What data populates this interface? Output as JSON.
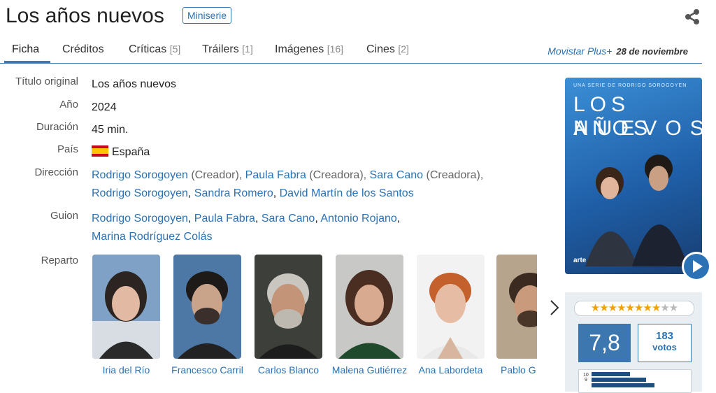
{
  "header": {
    "title": "Los años nuevos",
    "badge": "Miniserie"
  },
  "tabs": [
    {
      "label": "Ficha",
      "count": ""
    },
    {
      "label": "Créditos",
      "count": ""
    },
    {
      "label": "Críticas",
      "count": "[5]"
    },
    {
      "label": "Tráilers",
      "count": "[1]"
    },
    {
      "label": "Imágenes",
      "count": "[16]"
    },
    {
      "label": "Cines",
      "count": "[2]"
    }
  ],
  "release": {
    "network": "Movistar Plus+",
    "date": "28 de noviembre"
  },
  "details": {
    "original_title": {
      "label": "Título original",
      "value": "Los años nuevos"
    },
    "year": {
      "label": "Año",
      "value": "2024"
    },
    "duration": {
      "label": "Duración",
      "value": "45 min."
    },
    "country": {
      "label": "País",
      "value": "España"
    },
    "direction": {
      "label": "Dirección",
      "p1": "Rodrigo Sorogoyen",
      "r1": " (Creador), ",
      "p2": "Paula Fabra",
      "r2": " (Creadora), ",
      "p3": "Sara Cano",
      "r3": " (Creadora),",
      "p4": "Rodrigo Sorogoyen",
      "s4": ", ",
      "p5": "Sandra Romero",
      "s5": ", ",
      "p6": "David Martín de los Santos"
    },
    "script": {
      "label": "Guion",
      "p1": "Rodrigo Sorogoyen",
      "p2": "Paula Fabra",
      "p3": "Sara Cano",
      "p4": "Antonio Rojano",
      "p5": "Marina Rodríguez Colás",
      "sep": ", "
    },
    "cast_label": "Reparto"
  },
  "cast": [
    {
      "name": "Iria del Río"
    },
    {
      "name": "Francesco Carril"
    },
    {
      "name": "Carlos Blanco"
    },
    {
      "name": "Malena Gutiérrez"
    },
    {
      "name": "Ana Labordeta"
    },
    {
      "name": "Pablo G"
    }
  ],
  "poster": {
    "top_text": "UNA SERIE DE RODRIGO SOROGOYEN",
    "title_line1": "LOS AÑOS",
    "title_line2": "NUEVOS",
    "brand": "arte"
  },
  "rating": {
    "stars_filled": 8,
    "stars_total": 10,
    "score": "7,8",
    "votes_count": "183",
    "votes_label": "votos",
    "hist_top": "10",
    "hist_mid": "9"
  },
  "colors": {
    "accent": "#2a72b5",
    "score_bg": "#3d77b0",
    "star": "#f4a100"
  },
  "icons": {
    "share": "share-icon",
    "play": "play-icon",
    "next": "chevron-right-icon",
    "flag": "spain-flag-icon"
  }
}
